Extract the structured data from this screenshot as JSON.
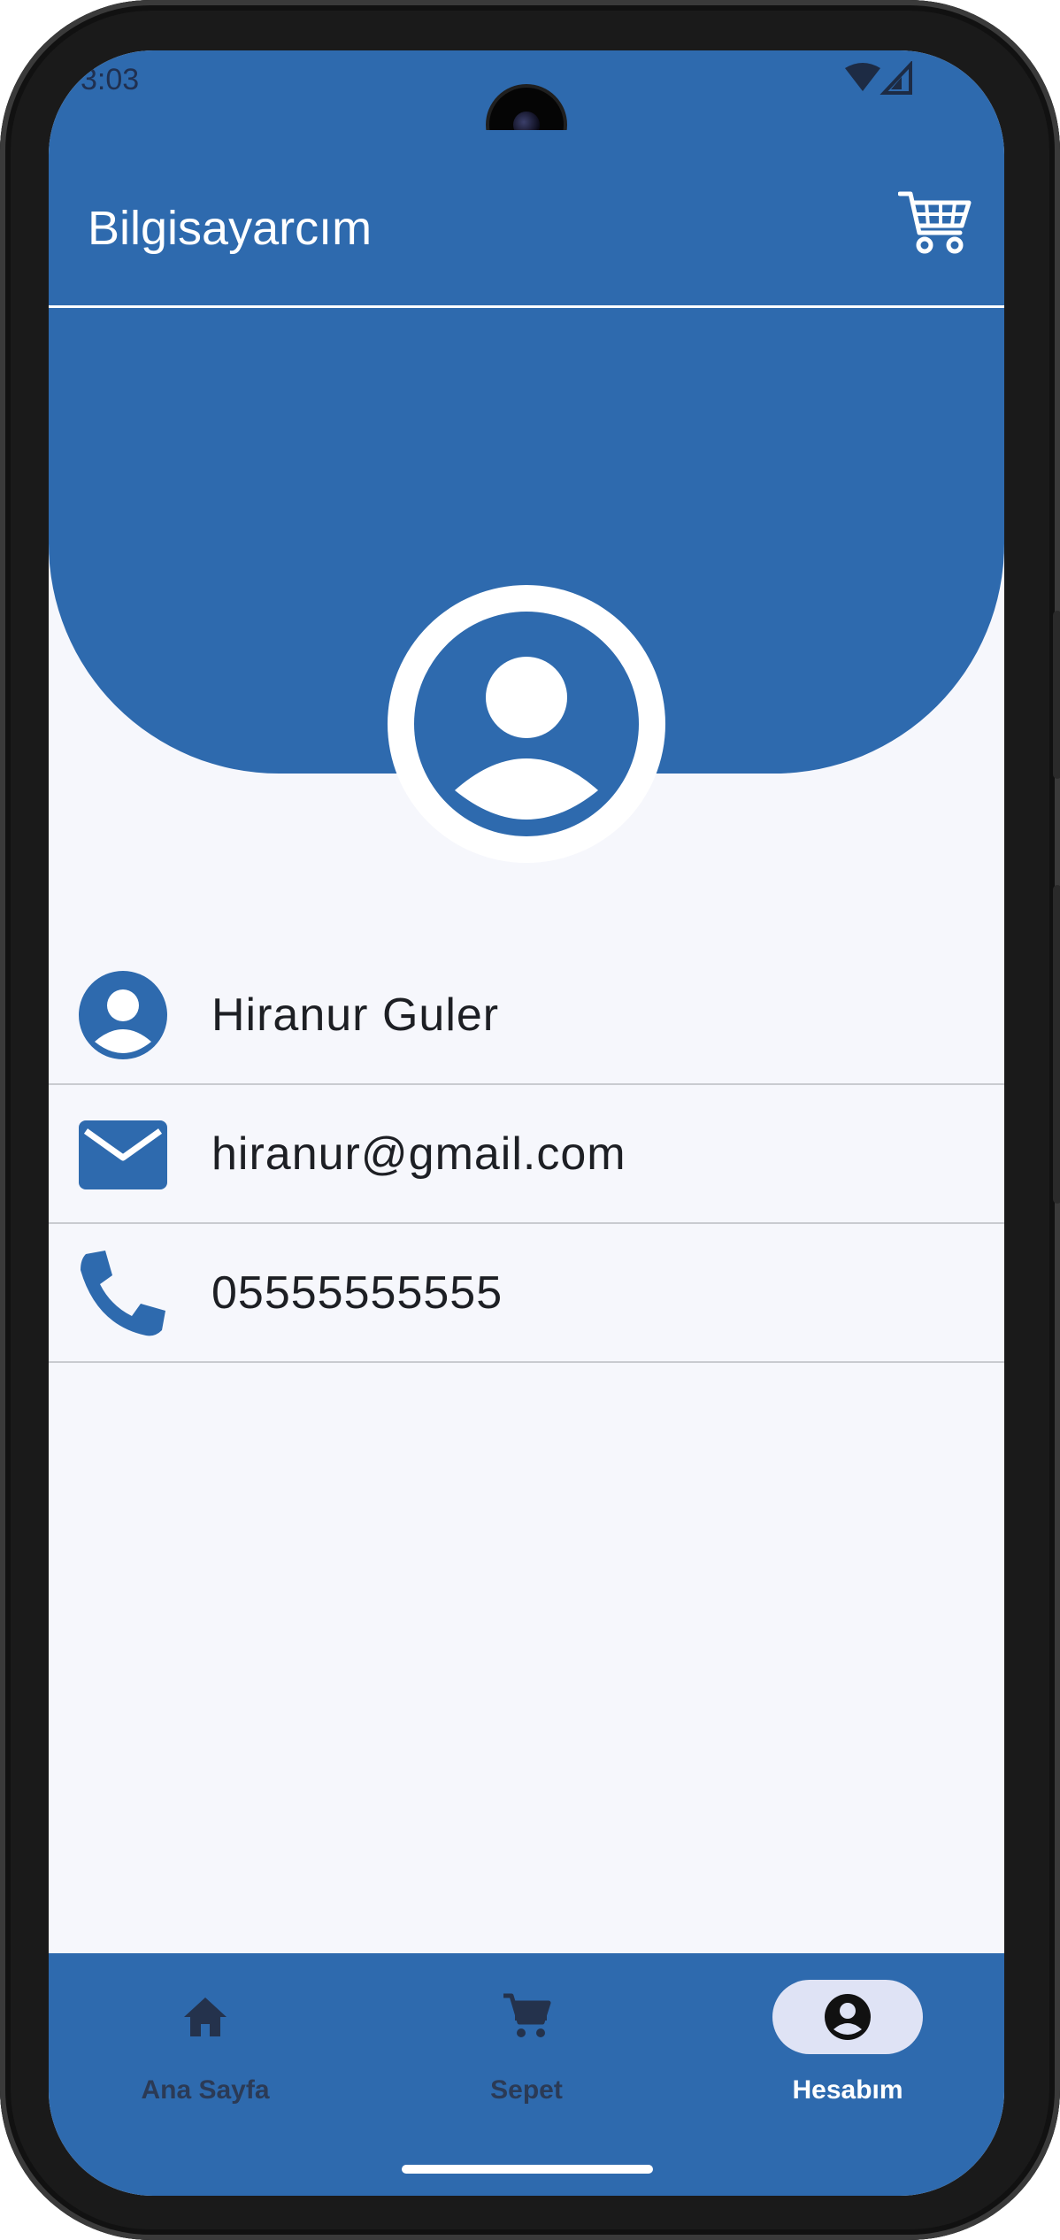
{
  "status_bar": {
    "time": "3:03"
  },
  "app_bar": {
    "title": "Bilgisayarcım",
    "cart_icon": "shopping-cart-icon"
  },
  "profile": {
    "avatar_icon": "account-circle-icon",
    "fields": [
      {
        "icon": "account-circle-icon",
        "value": "Hiranur Guler"
      },
      {
        "icon": "mail-icon",
        "value": "hiranur@gmail.com"
      },
      {
        "icon": "phone-icon",
        "value": "05555555555"
      }
    ]
  },
  "bottom_nav": {
    "items": [
      {
        "label": "Ana Sayfa",
        "icon": "home-icon",
        "active": false
      },
      {
        "label": "Sepet",
        "icon": "cart-icon",
        "active": false
      },
      {
        "label": "Hesabım",
        "icon": "account-icon",
        "active": true
      }
    ]
  },
  "colors": {
    "primary": "#2e6aae",
    "background": "#f6f7fc",
    "active_pill": "#dfe3f5",
    "divider": "#c9cbd0"
  }
}
